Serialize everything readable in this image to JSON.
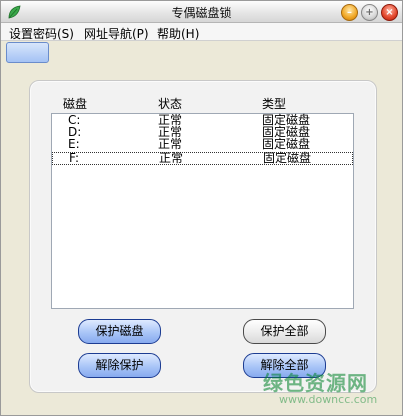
{
  "window": {
    "title": "专偶磁盘锁"
  },
  "menu": [
    {
      "label": "设置密码(S)"
    },
    {
      "label": "网址导航(P)"
    },
    {
      "label": "帮助(H)"
    }
  ],
  "list": {
    "columns": [
      "磁盘",
      "状态",
      "类型"
    ],
    "rows": [
      {
        "disk": "C:",
        "state": "正常",
        "type": "固定磁盘"
      },
      {
        "disk": "D:",
        "state": "正常",
        "type": "固定磁盘"
      },
      {
        "disk": "E:",
        "state": "正常",
        "type": "固定磁盘"
      },
      {
        "disk": "F:",
        "state": "正常",
        "type": "固定磁盘"
      }
    ]
  },
  "buttons": {
    "protect_disk": "保护磁盘",
    "protect_all": "保护全部",
    "unprotect": "解除保护",
    "unprotect_all": "解除全部"
  },
  "watermark": {
    "brand": "绿色资源网",
    "url": "www.downcc.com"
  },
  "colors": {
    "accent_blue": "#87aaef",
    "title_bar": "#e6e6e6",
    "close": "#e2452a",
    "minimize": "#f0a623"
  },
  "icons": {
    "app": "leaf-icon",
    "minimize": "minimize-icon",
    "maximize": "maximize-icon",
    "close": "close-icon"
  }
}
